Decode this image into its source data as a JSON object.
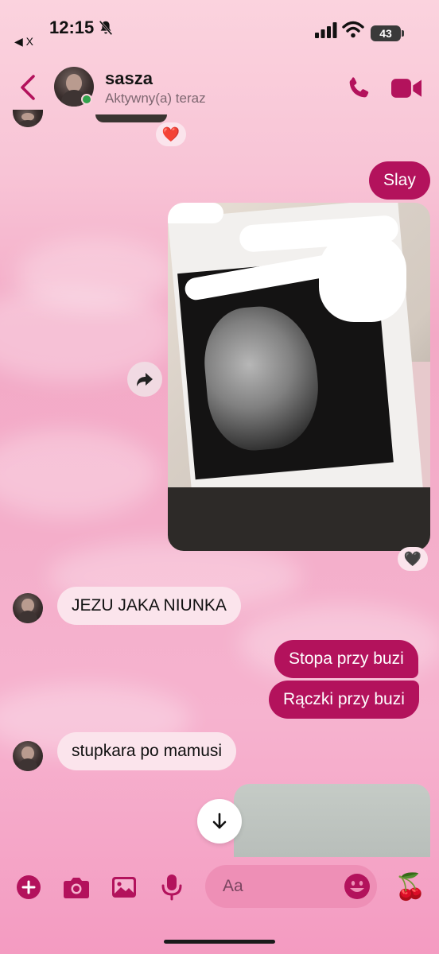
{
  "status_bar": {
    "time": "12:15",
    "back_app_label": "◀ X",
    "battery": "43"
  },
  "header": {
    "contact_name": "sasza",
    "contact_status": "Aktywny(a) teraz"
  },
  "messages": [
    {
      "direction": "in",
      "type": "image",
      "reaction": "❤️"
    },
    {
      "direction": "out",
      "type": "text",
      "text": "Slay"
    },
    {
      "direction": "out",
      "type": "image",
      "reaction": "🖤"
    },
    {
      "direction": "in",
      "type": "text",
      "text": "JEZU JAKA NIUNKA"
    },
    {
      "direction": "out",
      "type": "text",
      "text": "Stopa przy buzi"
    },
    {
      "direction": "out",
      "type": "text",
      "text": "Rączki przy buzi"
    },
    {
      "direction": "in",
      "type": "text",
      "text": "stupkara po mamusi"
    },
    {
      "direction": "out",
      "type": "image"
    }
  ],
  "composer": {
    "placeholder": "Aa",
    "quick_reaction": "🍒"
  },
  "icons": [
    "bell-slash-icon",
    "signal-icon",
    "wifi-icon",
    "back-chevron-icon",
    "phone-icon",
    "video-icon",
    "share-icon",
    "arrow-down-icon",
    "plus-icon",
    "camera-icon",
    "image-icon",
    "microphone-icon",
    "emoji-icon"
  ],
  "colors": {
    "accent": "#b3125c",
    "incoming_bubble": "#fbe4ec",
    "online": "#31a24c"
  }
}
